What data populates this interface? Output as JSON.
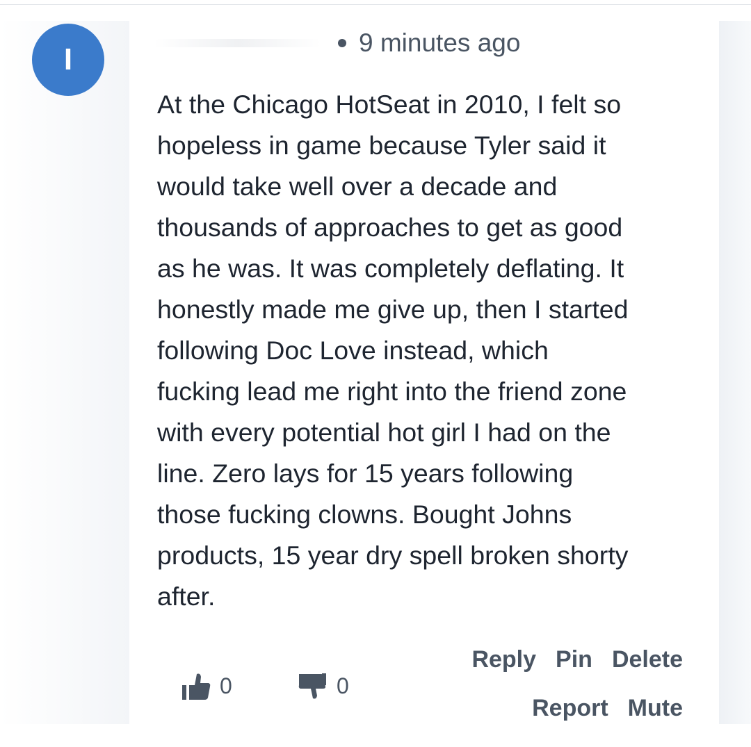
{
  "avatar": {
    "letter": "I",
    "color": "#3b7bcb"
  },
  "meta": {
    "time": "9 minutes ago"
  },
  "comment": {
    "text": "At the Chicago HotSeat in 2010, I felt so\nhopeless in game because Tyler said it\nwould take well over a decade and\nthousands of approaches to get as good\nas he was. It was completely deflating. It\nhonestly made me give up, then I started\nfollowing Doc Love instead, which\nfucking lead me right into the friend zone\nwith every potential hot girl I had on the\nline. Zero lays for 15 years following\nthose fucking clowns. Bought Johns\nproducts, 15 year dry spell broken shorty\nafter."
  },
  "votes": {
    "upvote_icon": "thumbs-up-icon",
    "upvotes": "0",
    "downvote_icon": "thumbs-down-icon",
    "downvotes": "0"
  },
  "actions": {
    "reply": "Reply",
    "pin": "Pin",
    "delete": "Delete",
    "report": "Report",
    "mute": "Mute"
  }
}
